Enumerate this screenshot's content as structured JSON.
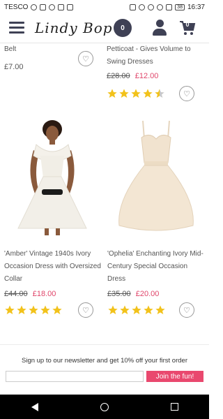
{
  "status_bar": {
    "carrier": "TESCO",
    "battery": "38",
    "time": "16:37"
  },
  "header": {
    "logo_text": "Lindy Bop",
    "wishlist_count": "0",
    "cart_count": "0"
  },
  "products": [
    {
      "title": "Belt",
      "price": "£7.00",
      "old_price": "",
      "new_price": ""
    },
    {
      "title": "Petticoat - Gives Volume to Swing Dresses",
      "old_price": "£28.00",
      "new_price": "£12.00",
      "rating": 4.5
    },
    {
      "title": "'Amber' Vintage 1940s Ivory Occasion Dress with Oversized Collar",
      "old_price": "£44.00",
      "new_price": "£18.00",
      "rating": 5
    },
    {
      "title": "'Ophelia' Enchanting Ivory Mid-Century Special Occasion Dress",
      "old_price": "£35.00",
      "new_price": "£20.00",
      "rating": 5
    }
  ],
  "newsletter": {
    "text": "Sign up to our newsletter and get 10% off your first order",
    "input_placeholder": "",
    "button_label": "Join the fun!"
  },
  "colors": {
    "accent": "#e9486e",
    "star": "#f2c21b",
    "nav_dark": "#3f4155"
  }
}
